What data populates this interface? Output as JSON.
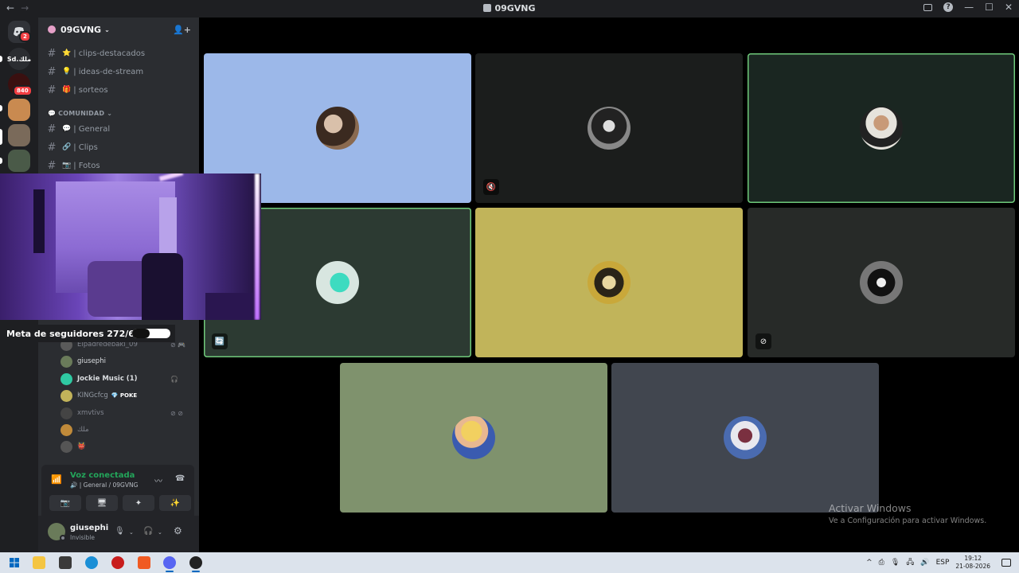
{
  "window": {
    "title": "09GVNG",
    "back_label": "←",
    "forward_label": "→",
    "help_label": "?",
    "minimize_label": "—",
    "maximize_label": "☐",
    "close_label": "✕"
  },
  "rail": {
    "home_badge": "2",
    "server2_label": "Sd.ملك",
    "server3_badge": "840"
  },
  "server": {
    "name": "09GVNG",
    "chevron": "⌄",
    "invite_icon": "👤+"
  },
  "channels": [
    {
      "emoji": "⭐",
      "name": "| clips-destacados"
    },
    {
      "emoji": "💡",
      "name": "| ideas-de-stream"
    },
    {
      "emoji": "🎁",
      "name": "| sorteos"
    }
  ],
  "category": {
    "name": "COMUNIDAD",
    "chevron": "⌄",
    "emoji": "💬"
  },
  "community_channels": [
    {
      "emoji": "💬",
      "name": "| General"
    },
    {
      "emoji": "🔗",
      "name": "| Clips"
    },
    {
      "emoji": "📷",
      "name": "| Fotos"
    }
  ],
  "voice_members": [
    {
      "name": "Elpadredebaki_09",
      "tags": "⊘ 🎮",
      "dim": true,
      "color": "#5a5a5a"
    },
    {
      "name": "giusephi",
      "tags": "",
      "dim": false,
      "color": "#6a7b5a"
    },
    {
      "name": "Jockie Music (1)",
      "tags": "🎧",
      "dim": false,
      "color": "#2fc9a2"
    },
    {
      "name": "KINGcfcg",
      "tags": "",
      "dim": false,
      "badge": "💎 POKE",
      "color": "#c2b35a"
    },
    {
      "name": "xmvtivs",
      "tags": "⊘ ⊘",
      "dim": true,
      "color": "#444"
    },
    {
      "name": "ملك",
      "tags": "",
      "dim": true,
      "color": "#c08a3a"
    },
    {
      "name": "👹",
      "tags": "",
      "dim": false,
      "color": "#555"
    }
  ],
  "voice_panel": {
    "title": "Voz conectada",
    "subtitle": "🔊 | General / 09GVNG",
    "signal_icon": "📶",
    "noise_icon": "〰",
    "disconnect_icon": "☎",
    "buttons": [
      "📷",
      "🖥",
      "✦",
      "✨"
    ]
  },
  "user": {
    "name": "giusephi",
    "status": "Invisible",
    "mic_icon": "🎙",
    "headset_icon": "🎧",
    "settings_icon": "⚙"
  },
  "overlay": {
    "goal_label": "Meta de seguidores 272/600",
    "goal_current": 272,
    "goal_target": 600
  },
  "tiles": [
    {
      "bg": "#9cb8e9",
      "speaking": false,
      "icon": "",
      "avatar_color": "#3b2a20"
    },
    {
      "bg": "#1b1d1c",
      "speaking": false,
      "icon": "🔇",
      "avatar_color": "#333"
    },
    {
      "bg": "#1a2621",
      "speaking": true,
      "icon": "",
      "avatar_color": "#e6e3dc"
    },
    {
      "bg": "#2c3a32",
      "speaking": true,
      "icon": "🔄",
      "avatar_color": "#d8e6e0"
    },
    {
      "bg": "#c1b45a",
      "speaking": false,
      "icon": "",
      "avatar_color": "#2a2418"
    },
    {
      "bg": "#272a28",
      "speaking": false,
      "icon": "⊘",
      "avatar_color": "#555"
    },
    {
      "bg": "#7f926d",
      "speaking": false,
      "icon": "",
      "avatar_color": "#e1b93a"
    },
    {
      "bg": "#41464f",
      "speaking": false,
      "icon": "",
      "avatar_color": "#4a6bb0"
    }
  ],
  "watermark": {
    "line1": "Activar Windows",
    "line2": "Ve a Configuración para activar Windows."
  },
  "taskbar": {
    "language": "ESP",
    "time": "19:12",
    "date": "21-08-2026",
    "tray_icons": [
      "^",
      "⎙",
      "🎙",
      "🖧",
      "🔊"
    ]
  }
}
